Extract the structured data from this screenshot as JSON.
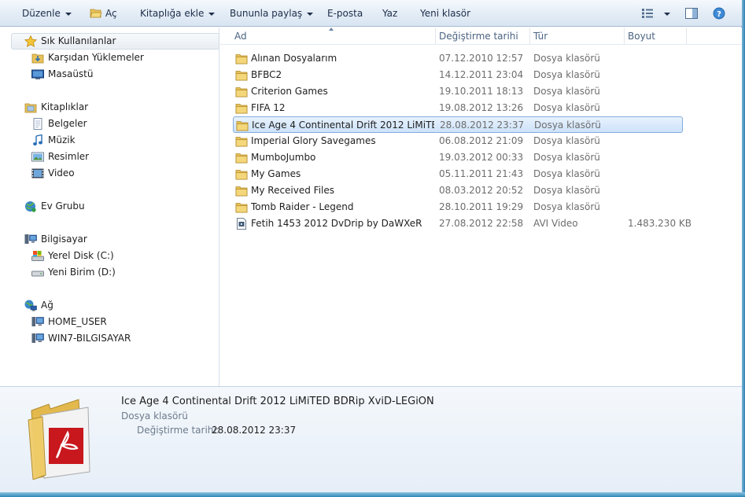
{
  "toolbar": {
    "organize": "Düzenle",
    "open": "Aç",
    "include_library": "Kitaplığa ekle",
    "share_with": "Bununla paylaş",
    "email": "E-posta",
    "burn": "Yaz",
    "new_folder": "Yeni klasör"
  },
  "nav": {
    "favorites": {
      "label": "Sık Kullanılanlar",
      "items": [
        "Karşıdan Yüklemeler",
        "Masaüstü"
      ]
    },
    "libraries": {
      "label": "Kitaplıklar",
      "items": [
        "Belgeler",
        "Müzik",
        "Resimler",
        "Video"
      ]
    },
    "homegroup": {
      "label": "Ev Grubu"
    },
    "computer": {
      "label": "Bilgisayar",
      "items": [
        "Yerel Disk (C:)",
        "Yeni Birim (D:)"
      ]
    },
    "network": {
      "label": "Ağ",
      "items": [
        "HOME_USER",
        "WIN7-BILGISAYAR"
      ]
    }
  },
  "columns": {
    "name": "Ad",
    "modified": "Değiştirme tarihi",
    "type": "Tür",
    "size": "Boyut"
  },
  "files": [
    {
      "name": "Alınan Dosyalarım",
      "modified": "07.12.2010 12:57",
      "type": "Dosya klasörü",
      "size": "",
      "icon": "folder-icon"
    },
    {
      "name": "BFBC2",
      "modified": "14.12.2011 23:04",
      "type": "Dosya klasörü",
      "size": "",
      "icon": "folder-icon"
    },
    {
      "name": "Criterion Games",
      "modified": "19.10.2011 18:13",
      "type": "Dosya klasörü",
      "size": "",
      "icon": "folder-icon"
    },
    {
      "name": "FIFA 12",
      "modified": "19.08.2012 13:26",
      "type": "Dosya klasörü",
      "size": "",
      "icon": "folder-icon"
    },
    {
      "name": "Ice Age 4 Continental Drift 2012 LiMiTED ...",
      "modified": "28.08.2012 23:37",
      "type": "Dosya klasörü",
      "size": "",
      "icon": "folder-icon",
      "selected": true
    },
    {
      "name": "Imperial Glory Savegames",
      "modified": "06.08.2012 21:09",
      "type": "Dosya klasörü",
      "size": "",
      "icon": "folder-icon"
    },
    {
      "name": "MumboJumbo",
      "modified": "19.03.2012 00:33",
      "type": "Dosya klasörü",
      "size": "",
      "icon": "folder-icon"
    },
    {
      "name": "My Games",
      "modified": "05.11.2011 21:43",
      "type": "Dosya klasörü",
      "size": "",
      "icon": "folder-icon"
    },
    {
      "name": "My Received Files",
      "modified": "08.03.2012 20:52",
      "type": "Dosya klasörü",
      "size": "",
      "icon": "folder-icon"
    },
    {
      "name": "Tomb Raider - Legend",
      "modified": "28.10.2011 19:29",
      "type": "Dosya klasörü",
      "size": "",
      "icon": "folder-icon"
    },
    {
      "name": "Fetih 1453 2012 DvDrip by DaWXeR",
      "modified": "27.08.2012 22:58",
      "type": "AVI Video",
      "size": "1.483.230 KB",
      "icon": "video-file-icon"
    }
  ],
  "details": {
    "title": "Ice Age 4 Continental Drift 2012 LiMiTED BDRip XviD-LEGiON",
    "type": "Dosya klasörü",
    "modified_label": "Değiştirme tarihi:",
    "modified_value": "28.08.2012 23:37"
  },
  "colors": {
    "folder": "#e8c25a",
    "selection": "#cde2fa",
    "selection_border": "#84acdd",
    "header_text": "#4b6382"
  }
}
